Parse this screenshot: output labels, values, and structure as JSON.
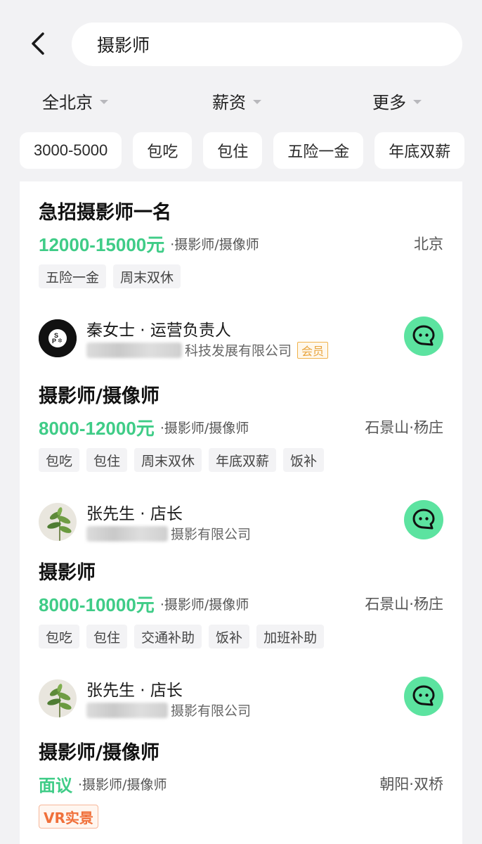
{
  "search": {
    "query": "摄影师"
  },
  "filters": [
    {
      "label": "全北京"
    },
    {
      "label": "薪资"
    },
    {
      "label": "更多"
    }
  ],
  "chips": [
    "3000-5000",
    "包吃",
    "包住",
    "五险一金",
    "年底双薪"
  ],
  "jobs": [
    {
      "title": "急招摄影师一名",
      "salary": "12000-15000元",
      "category": "·摄影师/摄像师",
      "location": "北京",
      "tags": [
        "五险一金",
        "周末双休"
      ],
      "recruiter": "秦女士 · 运营负责人",
      "company": "科技发展有限公司",
      "member_badge": "会员"
    },
    {
      "title": "摄影师/摄像师",
      "salary": "8000-12000元",
      "category": "·摄影师/摄像师",
      "location": "石景山·杨庄",
      "tags": [
        "包吃",
        "包住",
        "周末双休",
        "年底双薪",
        "饭补"
      ],
      "recruiter": "张先生 · 店长",
      "company": "摄影有限公司"
    },
    {
      "title": "摄影师",
      "salary": "8000-10000元",
      "category": "·摄影师/摄像师",
      "location": "石景山·杨庄",
      "tags": [
        "包吃",
        "包住",
        "交通补助",
        "饭补",
        "加班补助"
      ],
      "recruiter": "张先生 · 店长",
      "company": "摄影有限公司"
    },
    {
      "title": "摄影师/摄像师",
      "salary": "面议",
      "category": "·摄影师/摄像师",
      "location": "朝阳·双桥",
      "vr_badge": "VR实景"
    }
  ],
  "colors": {
    "accent": "#3fcc87",
    "chat_button": "#5ce3a0",
    "background": "#f2f2f4"
  }
}
